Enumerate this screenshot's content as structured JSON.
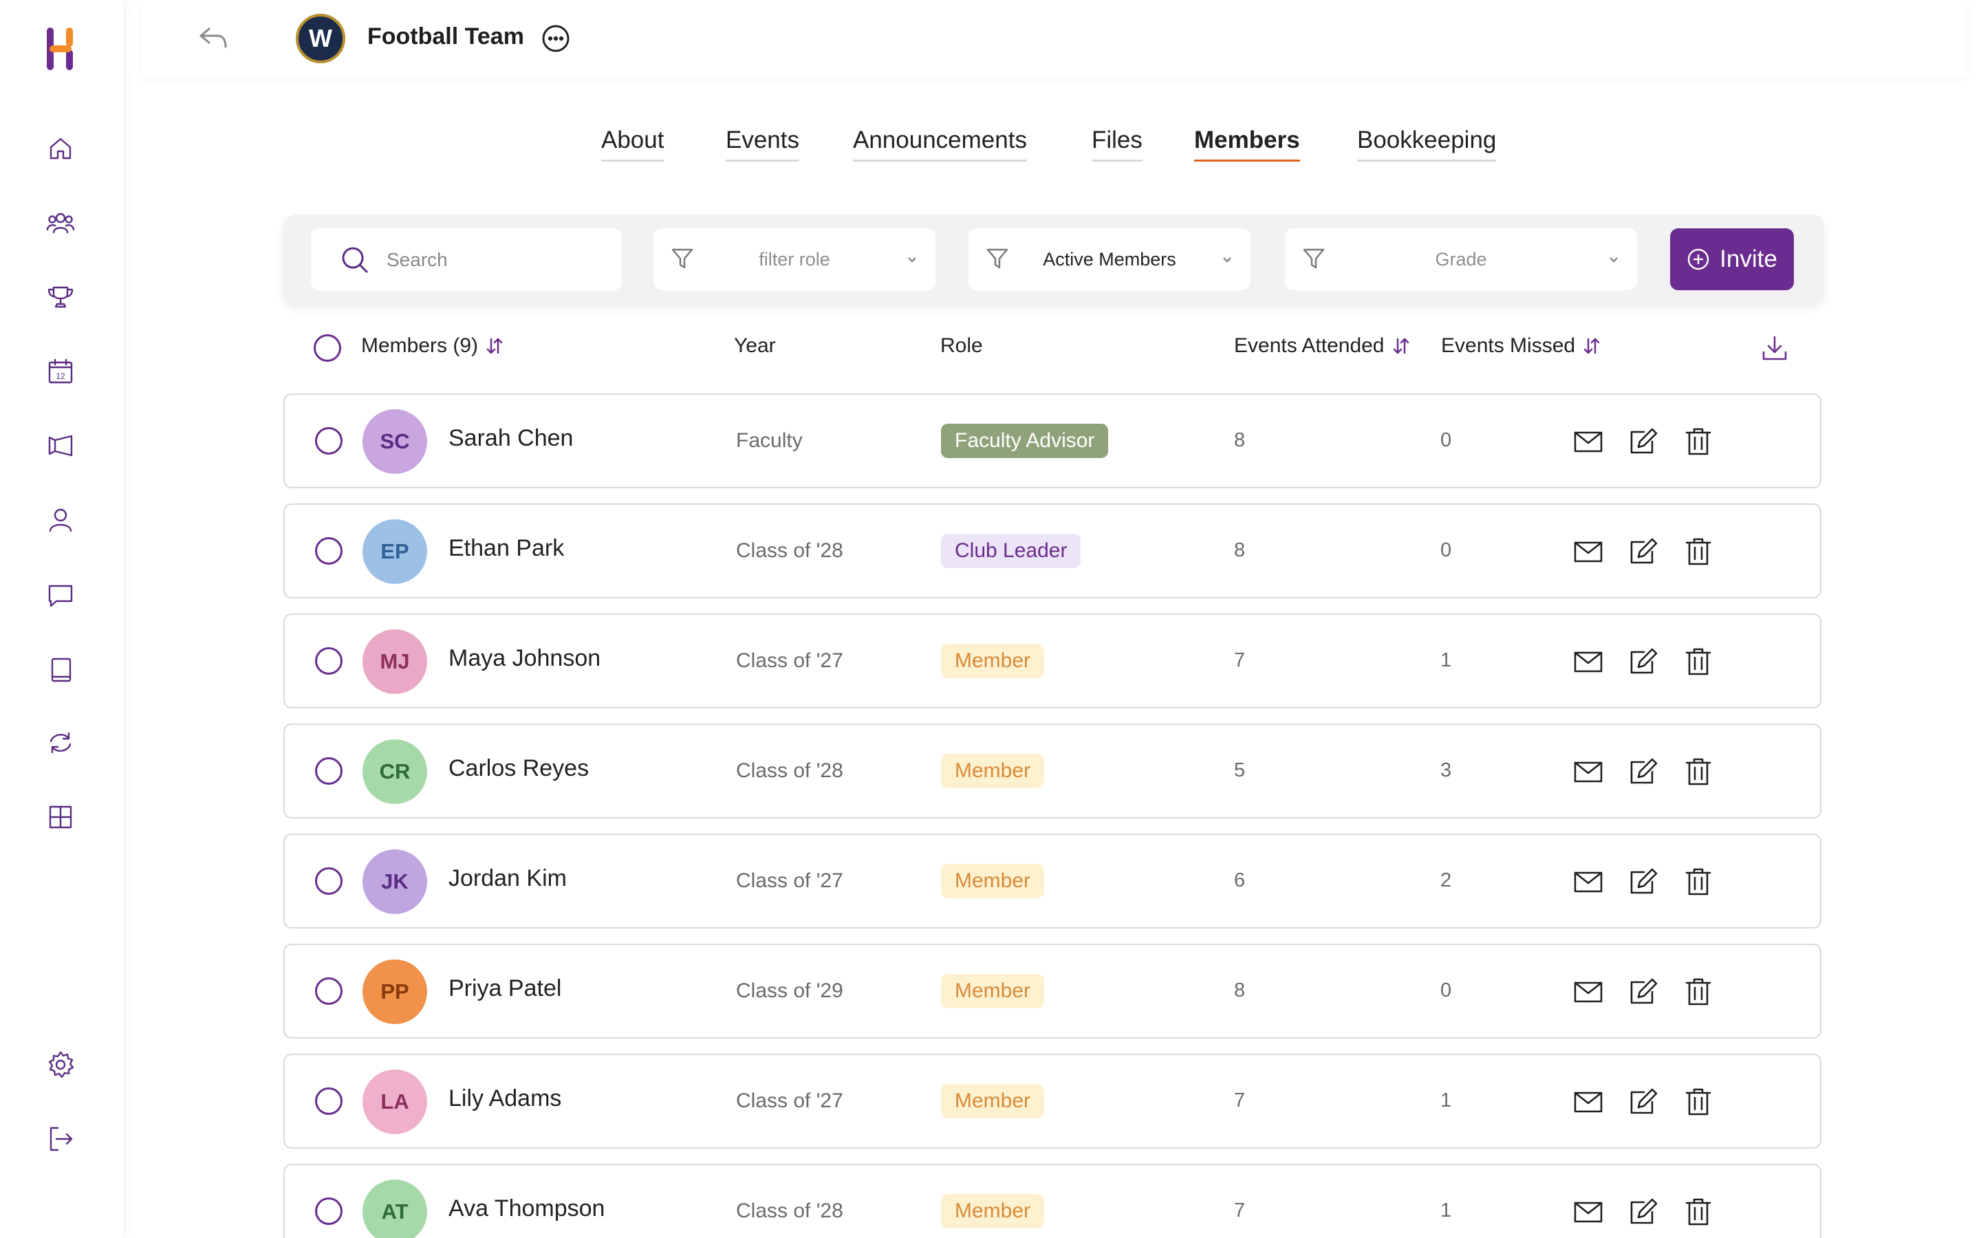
{
  "app": {
    "nav_icons": [
      "home-icon",
      "group-icon",
      "trophy-icon",
      "calendar-icon",
      "megaphone-icon",
      "user-icon",
      "chat-icon",
      "book-icon",
      "sync-icon",
      "grid-icon",
      "settings-icon",
      "logout-icon"
    ],
    "calendar_day": "12"
  },
  "header": {
    "team_initial": "W",
    "team_name": "Football Team"
  },
  "tabs": [
    {
      "label": "About",
      "active": false
    },
    {
      "label": "Events",
      "active": false
    },
    {
      "label": "Announcements",
      "active": false
    },
    {
      "label": "Files",
      "active": false
    },
    {
      "label": "Members",
      "active": true
    },
    {
      "label": "Bookkeeping",
      "active": false
    }
  ],
  "filters": {
    "search_placeholder": "Search",
    "role_placeholder": "filter role",
    "status_value": "Active Members",
    "grade_placeholder": "Grade",
    "invite_label": "Invite"
  },
  "columns": {
    "members": "Members (9)",
    "year": "Year",
    "role": "Role",
    "attended": "Events Attended",
    "missed": "Events Missed"
  },
  "members": [
    {
      "initials": "SC",
      "name": "Sarah Chen",
      "year": "Faculty",
      "role": "Faculty Advisor",
      "attended": "8",
      "missed": "0",
      "avatar_bg": "#c9a6e0",
      "avatar_fg": "#5b2c83",
      "badge_bg": "#8fa37a",
      "badge_fg": "#ffffff"
    },
    {
      "initials": "EP",
      "name": "Ethan Park",
      "year": "Class of '28",
      "role": "Club Leader",
      "attended": "8",
      "missed": "0",
      "avatar_bg": "#9cc0e6",
      "avatar_fg": "#2f5f94",
      "badge_bg": "#ece4f7",
      "badge_fg": "#6a2c8e"
    },
    {
      "initials": "MJ",
      "name": "Maya Johnson",
      "year": "Class of '27",
      "role": "Member",
      "attended": "7",
      "missed": "1",
      "avatar_bg": "#e9a9c6",
      "avatar_fg": "#8c2f5a",
      "badge_bg": "#fdf1cf",
      "badge_fg": "#d98a3a"
    },
    {
      "initials": "CR",
      "name": "Carlos Reyes",
      "year": "Class of '28",
      "role": "Member",
      "attended": "5",
      "missed": "3",
      "avatar_bg": "#a5d9a8",
      "avatar_fg": "#2f6b36",
      "badge_bg": "#fdf1cf",
      "badge_fg": "#d98a3a"
    },
    {
      "initials": "JK",
      "name": "Jordan Kim",
      "year": "Class of '27",
      "role": "Member",
      "attended": "6",
      "missed": "2",
      "avatar_bg": "#c0a6e0",
      "avatar_fg": "#5b2c83",
      "badge_bg": "#fdf1cf",
      "badge_fg": "#d98a3a"
    },
    {
      "initials": "PP",
      "name": "Priya Patel",
      "year": "Class of '29",
      "role": "Member",
      "attended": "8",
      "missed": "0",
      "avatar_bg": "#f0924a",
      "avatar_fg": "#8a3a0c",
      "badge_bg": "#fdf1cf",
      "badge_fg": "#d98a3a"
    },
    {
      "initials": "LA",
      "name": "Lily Adams",
      "year": "Class of '27",
      "role": "Member",
      "attended": "7",
      "missed": "1",
      "avatar_bg": "#efb0cc",
      "avatar_fg": "#8c2f5a",
      "badge_bg": "#fdf1cf",
      "badge_fg": "#d98a3a"
    },
    {
      "initials": "AT",
      "name": "Ava Thompson",
      "year": "Class of '28",
      "role": "Member",
      "attended": "7",
      "missed": "1",
      "avatar_bg": "#a5d9a8",
      "avatar_fg": "#2f6b36",
      "badge_bg": "#fdf1cf",
      "badge_fg": "#d98a3a"
    }
  ],
  "colors": {
    "accent": "#6a2c8e",
    "active_tab_underline": "#e0621f"
  }
}
